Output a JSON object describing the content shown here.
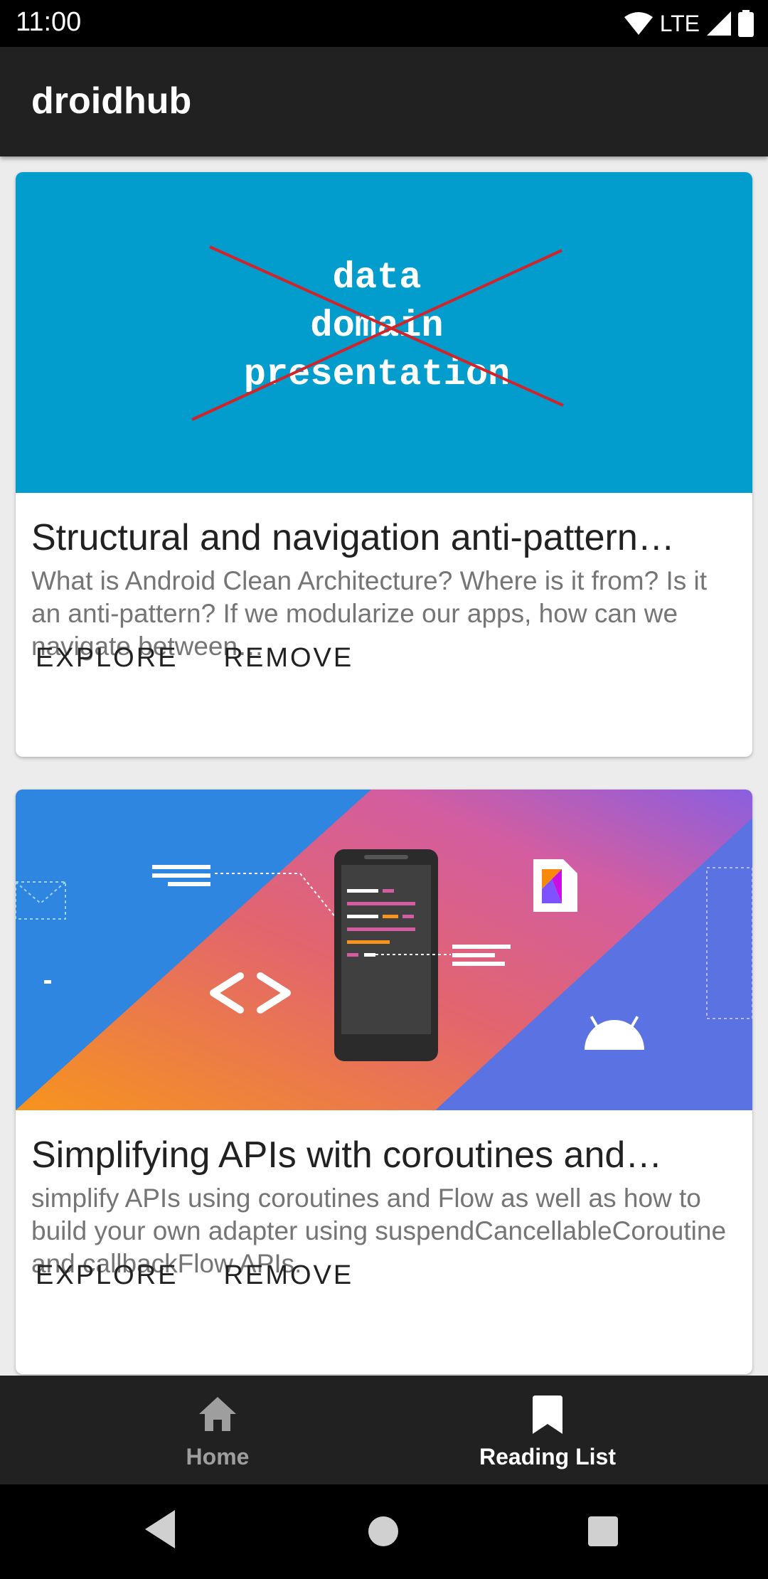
{
  "status_bar": {
    "time": "11:00",
    "network": "LTE"
  },
  "app_bar": {
    "title": "droidhub"
  },
  "cards": [
    {
      "title": "Structural and navigation anti-pattern…",
      "description": "What is Android Clean Architecture? Where is it from? Is it an anti-pattern? If we modularize our apps, how can we navigate between…",
      "image_text": [
        "data",
        "domain",
        "presentation"
      ],
      "explore_label": "EXPLORE",
      "remove_label": "REMOVE",
      "image_bg": "#029dcc"
    },
    {
      "title": "Simplifying APIs with coroutines and…",
      "description": "simplify APIs using coroutines and Flow as well as how to build your own adapter using suspendCancellableCoroutine and callbackFlow APIs.",
      "explore_label": "EXPLORE",
      "remove_label": "REMOVE"
    }
  ],
  "bottom_nav": {
    "items": [
      {
        "label": "Home",
        "icon": "home-icon",
        "selected": false
      },
      {
        "label": "Reading List",
        "icon": "bookmark-icon",
        "selected": true
      }
    ]
  },
  "colors": {
    "app_bar": "#212121",
    "nav_selected": "#ffffff",
    "nav_unselected": "#9e9e9e"
  }
}
